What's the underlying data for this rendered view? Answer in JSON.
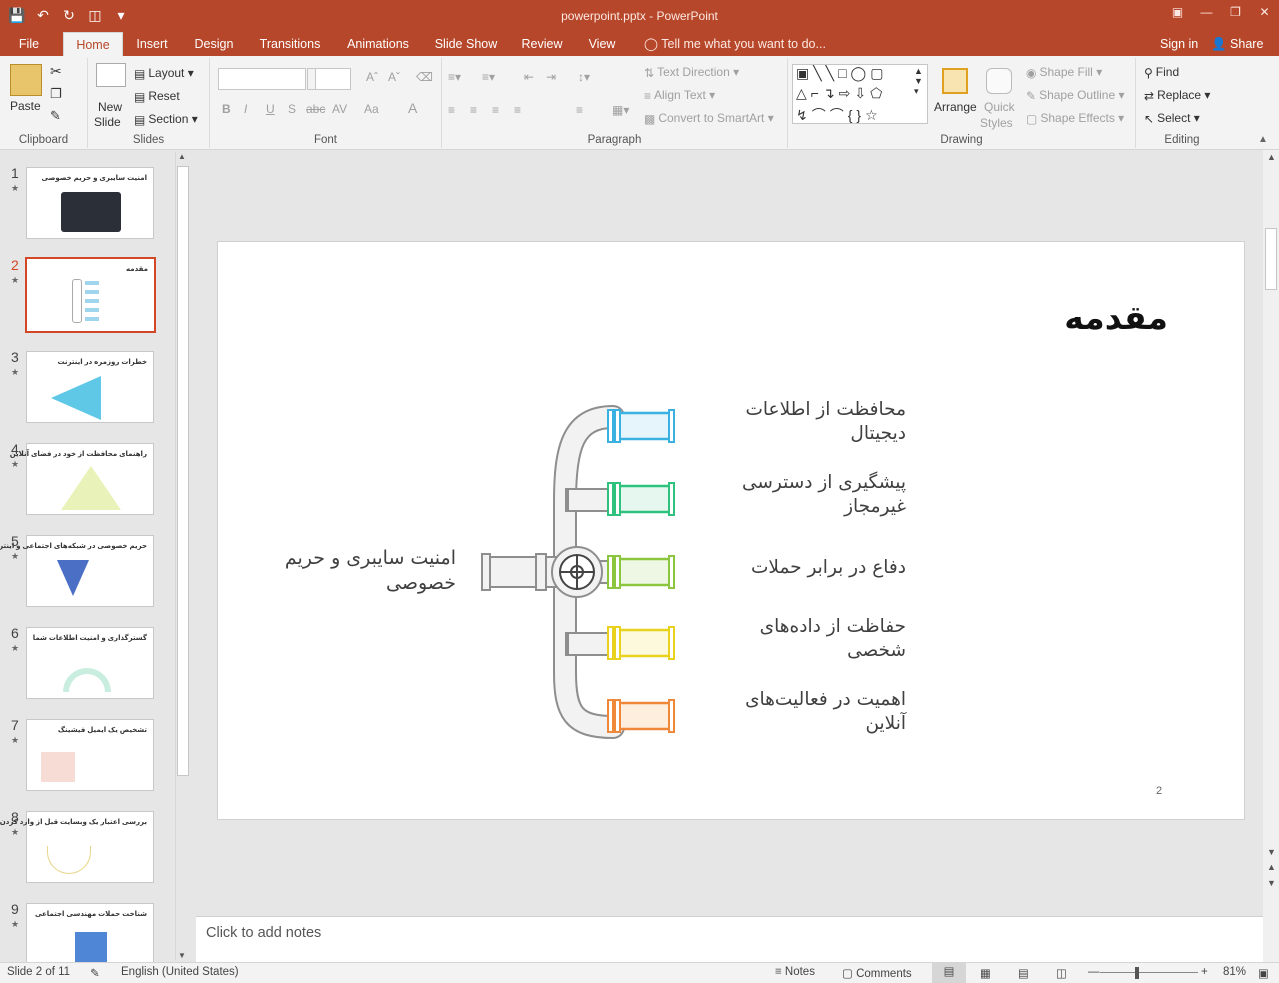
{
  "app": {
    "window_title": "powerpoint.pptx - PowerPoint"
  },
  "tabs": {
    "file": "File",
    "home": "Home",
    "insert": "Insert",
    "design": "Design",
    "transitions": "Transitions",
    "animations": "Animations",
    "slideshow": "Slide Show",
    "review": "Review",
    "view": "View",
    "tellme": "Tell me what you want to do...",
    "signin": "Sign in",
    "share": "Share"
  },
  "ribbon": {
    "clipboard": {
      "label": "Clipboard",
      "paste": "Paste"
    },
    "slides": {
      "label": "Slides",
      "new_slide_1": "New",
      "new_slide_2": "Slide",
      "layout": "Layout",
      "reset": "Reset",
      "section": "Section"
    },
    "font": {
      "label": "Font",
      "bold": "B",
      "italic": "I",
      "underline": "U",
      "shadow": "S",
      "strike": "abc",
      "spacing": "AV",
      "case": "Aa"
    },
    "paragraph": {
      "label": "Paragraph",
      "text_direction": "Text Direction",
      "align_text": "Align Text",
      "smartart": "Convert to SmartArt"
    },
    "drawing": {
      "label": "Drawing",
      "arrange": "Arrange",
      "quick_1": "Quick",
      "quick_2": "Styles",
      "shape_fill": "Shape Fill",
      "shape_outline": "Shape Outline",
      "shape_effects": "Shape Effects"
    },
    "editing": {
      "label": "Editing",
      "find": "Find",
      "replace": "Replace",
      "select": "Select"
    }
  },
  "thumbnails": [
    {
      "num": "1",
      "title": "امنیت سایبری و حریم خصوصی"
    },
    {
      "num": "2",
      "title": "مقدمه"
    },
    {
      "num": "3",
      "title": "خطرات روزمره در اینترنت"
    },
    {
      "num": "4",
      "title": "راهنمای محافظت از خود در فضای آنلاین"
    },
    {
      "num": "5",
      "title": "حریم خصوصی در شبکه‌های اجتماعی و اینترنت"
    },
    {
      "num": "6",
      "title": "گسترگذاری و امنیت اطلاعات شما"
    },
    {
      "num": "7",
      "title": "تشخیص یک ایمیل فیشینگ"
    },
    {
      "num": "8",
      "title": "بررسی اعتبار یک وبسایت قبل از وارد کردن اطلاعات"
    },
    {
      "num": "9",
      "title": "شناخت حملات مهندسی اجتماعی"
    }
  ],
  "slide": {
    "title": "مقدمه",
    "center_label_1": "امنیت سایبری و حریم",
    "center_label_2": "خصوصی",
    "items": [
      {
        "line1": "محافظت از اطلاعات",
        "line2": "دیجیتال",
        "color": "#3ab1e0",
        "fill": "#e6f5fb"
      },
      {
        "line1": "پیشگیری از دسترسی",
        "line2": "غیرمجاز",
        "color": "#2fc27f",
        "fill": "#e5f7ee"
      },
      {
        "line1": "دفاع در برابر حملات",
        "line2": "",
        "color": "#8cc63f",
        "fill": "#eef7e3"
      },
      {
        "line1": "حفاظت از داده‌های",
        "line2": "شخصی",
        "color": "#e8d21d",
        "fill": "#fcf9dd"
      },
      {
        "line1": "اهمیت در فعالیت‌های",
        "line2": "آنلاین",
        "color": "#f0883a",
        "fill": "#fdeede"
      }
    ],
    "page_number": "2"
  },
  "notes": {
    "placeholder": "Click to add notes"
  },
  "status": {
    "slide_of": "Slide 2 of 11",
    "language": "English (United States)",
    "notes": "Notes",
    "comments": "Comments",
    "zoom": "81%"
  }
}
